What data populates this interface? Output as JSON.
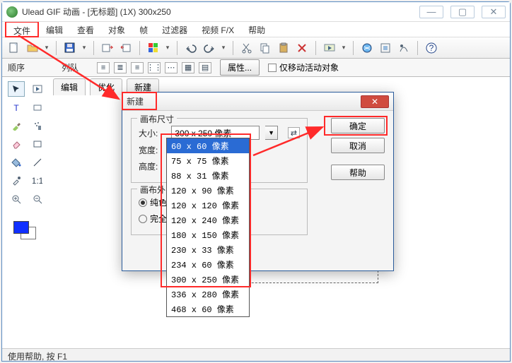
{
  "window": {
    "title": "Ulead GIF 动画 - [无标题] (1X) 300x250"
  },
  "menu": [
    "文件",
    "编辑",
    "查看",
    "对象",
    "帧",
    "过滤器",
    "视频 F/X",
    "帮助"
  ],
  "optionbar": {
    "seq_label": "顺序",
    "queue_label": "列队",
    "attr_button": "属性...",
    "move_only_label": "仅移动活动对象"
  },
  "right_tabs": [
    "编辑",
    "优化",
    "新建"
  ],
  "statusbar": "使用帮助, 按 F1",
  "dialog": {
    "title": "新建",
    "group_canvas": "画布尺寸",
    "size_label": "大小:",
    "size_value": "300 x 250 像素",
    "width_label": "宽度:",
    "height_label": "高度:",
    "group_bg": "画布外",
    "radio_solid": "纯色",
    "radio_full": "完全",
    "ok": "确定",
    "cancel": "取消",
    "help": "帮助"
  },
  "dropdown": [
    "60 x 60 像素",
    "75 x 75 像素",
    "88 x 31 像素",
    "120 x 90 像素",
    "120 x 120 像素",
    "120 x 240 像素",
    "180 x 150 像素",
    "230 x 33 像素",
    "234 x 60 像素",
    "300 x 250 像素",
    "336 x 280 像素",
    "468 x 60 像素"
  ]
}
